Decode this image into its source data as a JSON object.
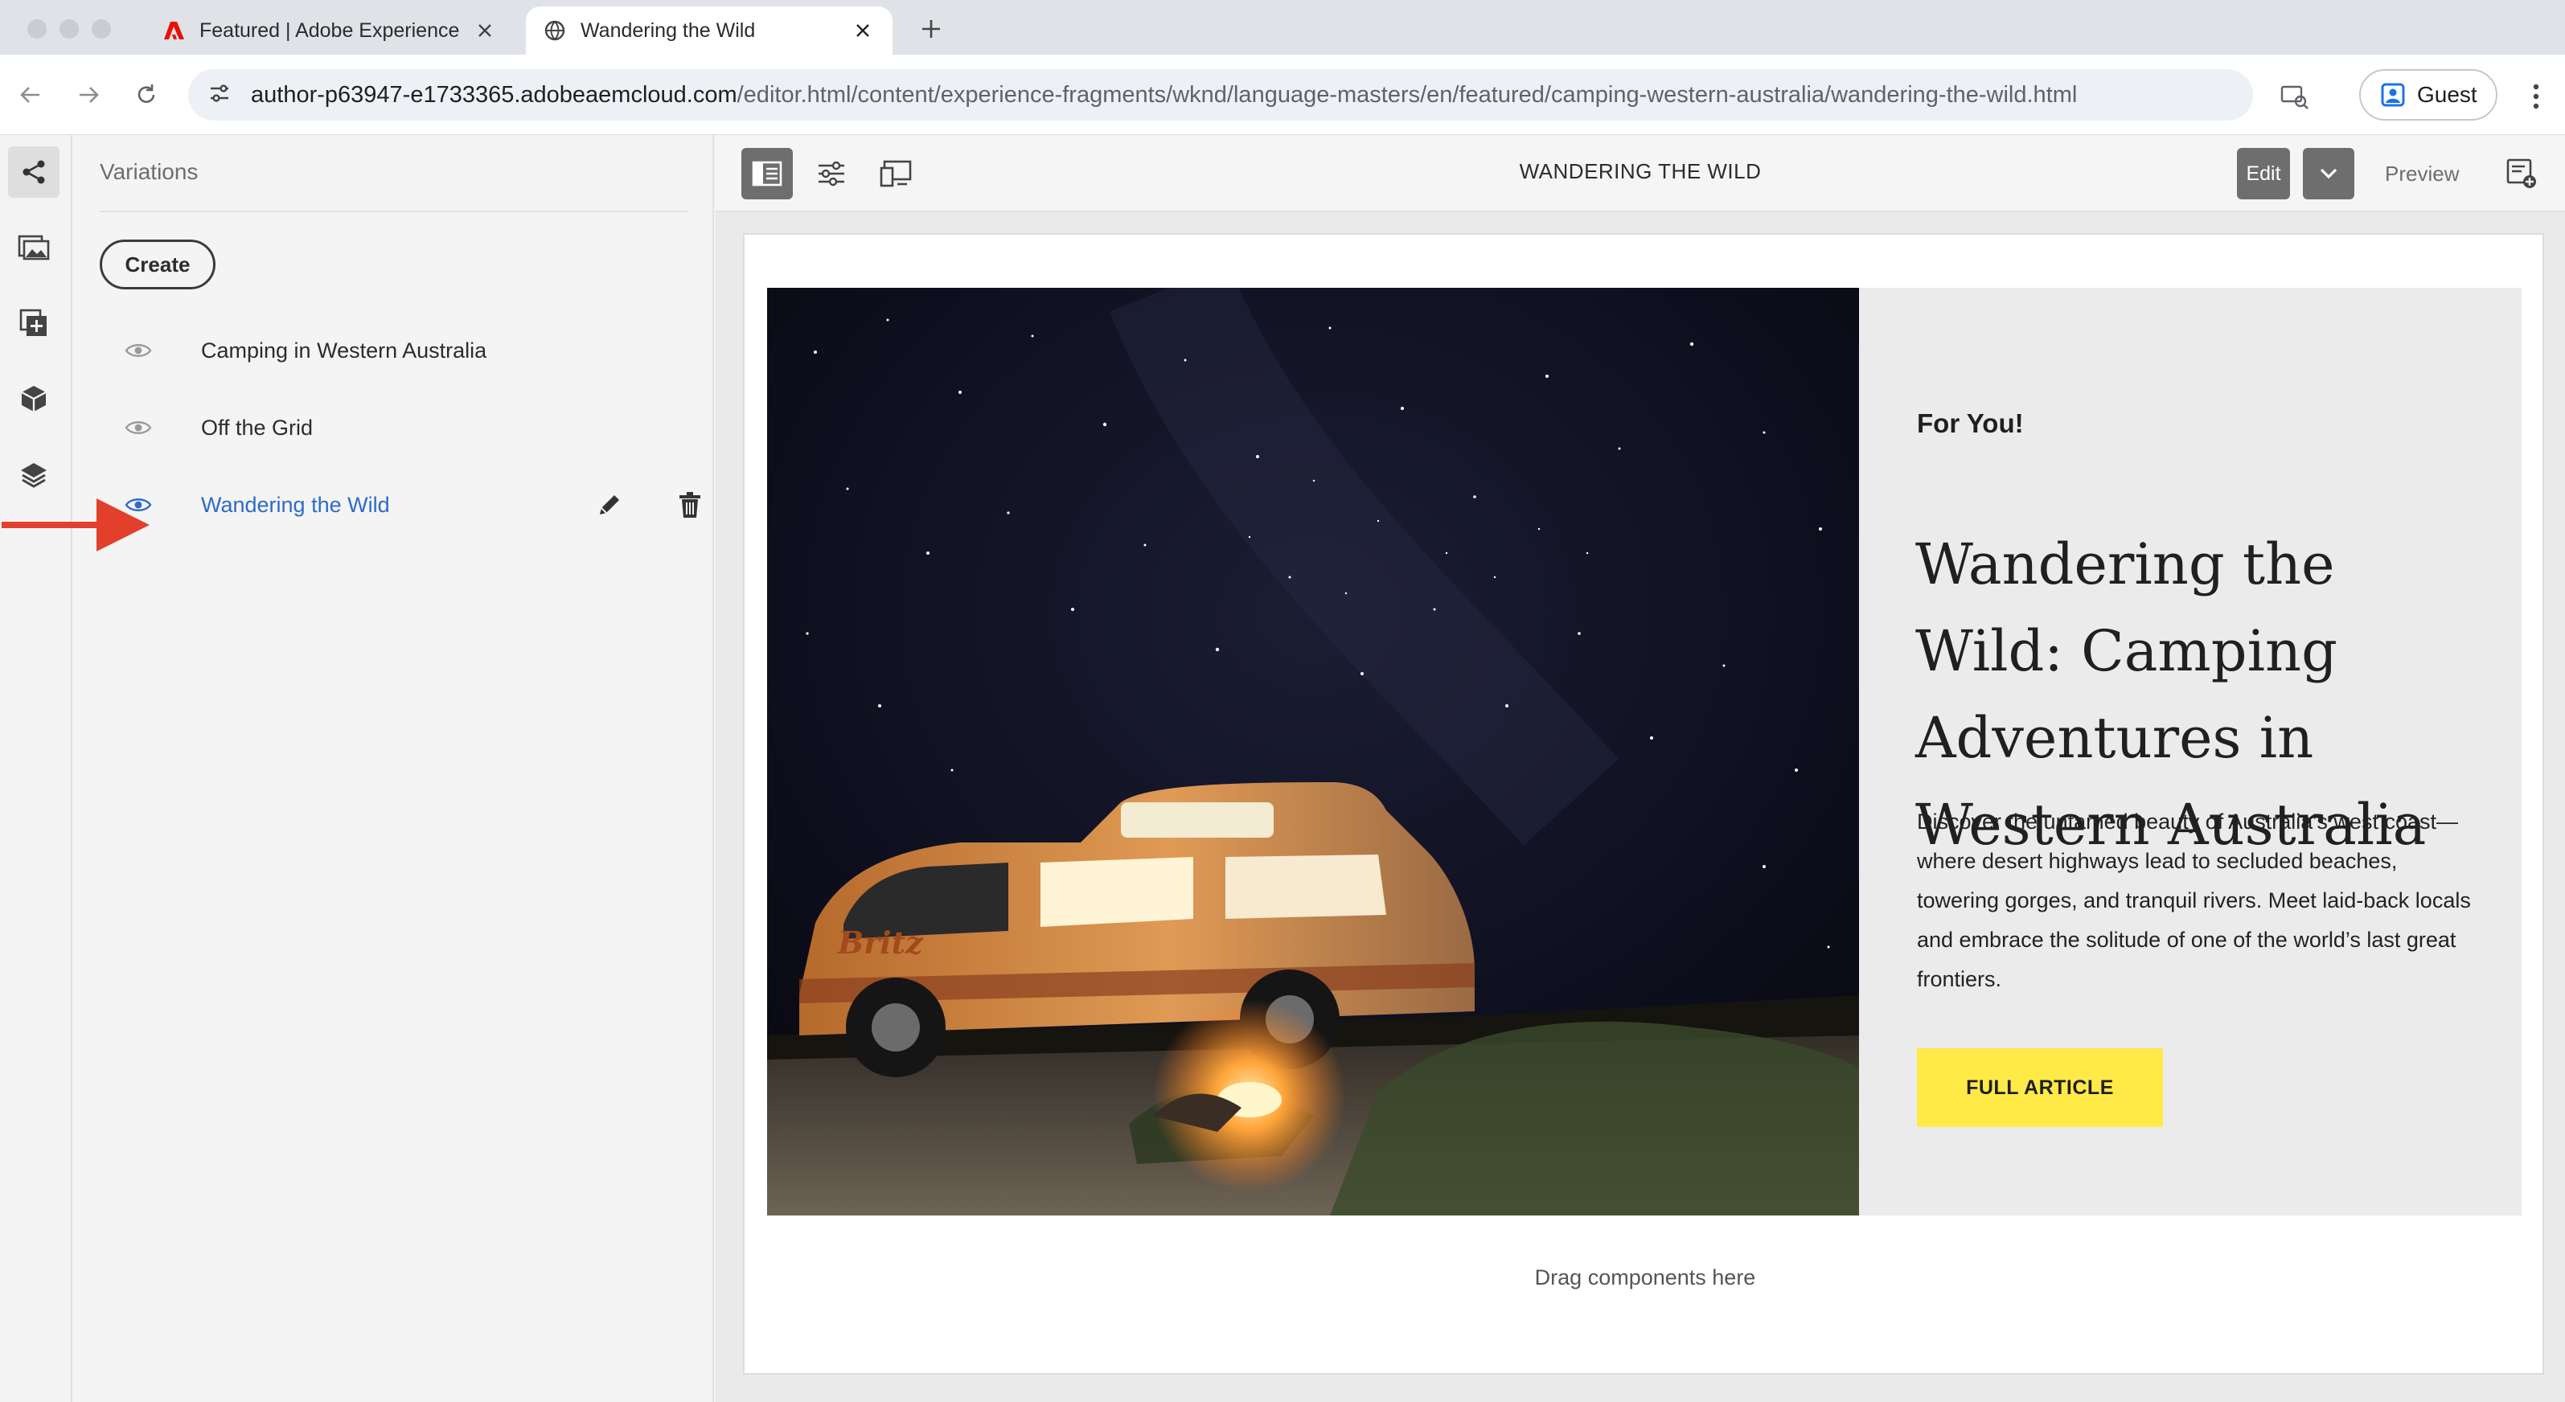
{
  "browser": {
    "tabs": [
      {
        "title": "Featured | Adobe Experience",
        "favicon": "adobe-icon",
        "active": false
      },
      {
        "title": "Wandering the Wild",
        "favicon": "globe-icon",
        "active": true
      }
    ],
    "url_host": "author-p63947-e1733365.adobeaemcloud.com",
    "url_path": "/editor.html/content/experience-fragments/wknd/language-masters/en/featured/camping-western-australia/wandering-the-wild.html",
    "profile_label": "Guest"
  },
  "rail": {
    "icons": [
      "share-tree-icon",
      "assets-icon",
      "add-component-icon",
      "components-cube-icon",
      "layers-icon"
    ],
    "selected": "share-tree-icon"
  },
  "panel": {
    "title": "Variations",
    "create_label": "Create",
    "variations": [
      {
        "label": "Camping in Western Australia",
        "selected": false
      },
      {
        "label": "Off the Grid",
        "selected": false
      },
      {
        "label": "Wandering the Wild",
        "selected": true
      }
    ]
  },
  "editor_toolbar": {
    "title": "WANDERING THE WILD",
    "edit_label": "Edit",
    "preview_label": "Preview"
  },
  "teaser": {
    "kicker": "For You!",
    "headline": "Wandering the Wild: Camping Adventures in Western Australia",
    "description": "Discover the untamed beauty of Australia's west coast—where desert highways lead to secluded beaches, towering gorges, and tranquil rivers. Meet laid-back locals and embrace the solitude of one of the world’s last great frontiers.",
    "cta_label": "FULL ARTICLE",
    "image_text": "Britz"
  },
  "drag_hint": "Drag components here",
  "colors": {
    "selected_blue": "#2d6bc9",
    "cta_yellow": "#ffea47",
    "arrow_red": "#e2402d",
    "toolbar_dark": "#6e6e6e"
  }
}
